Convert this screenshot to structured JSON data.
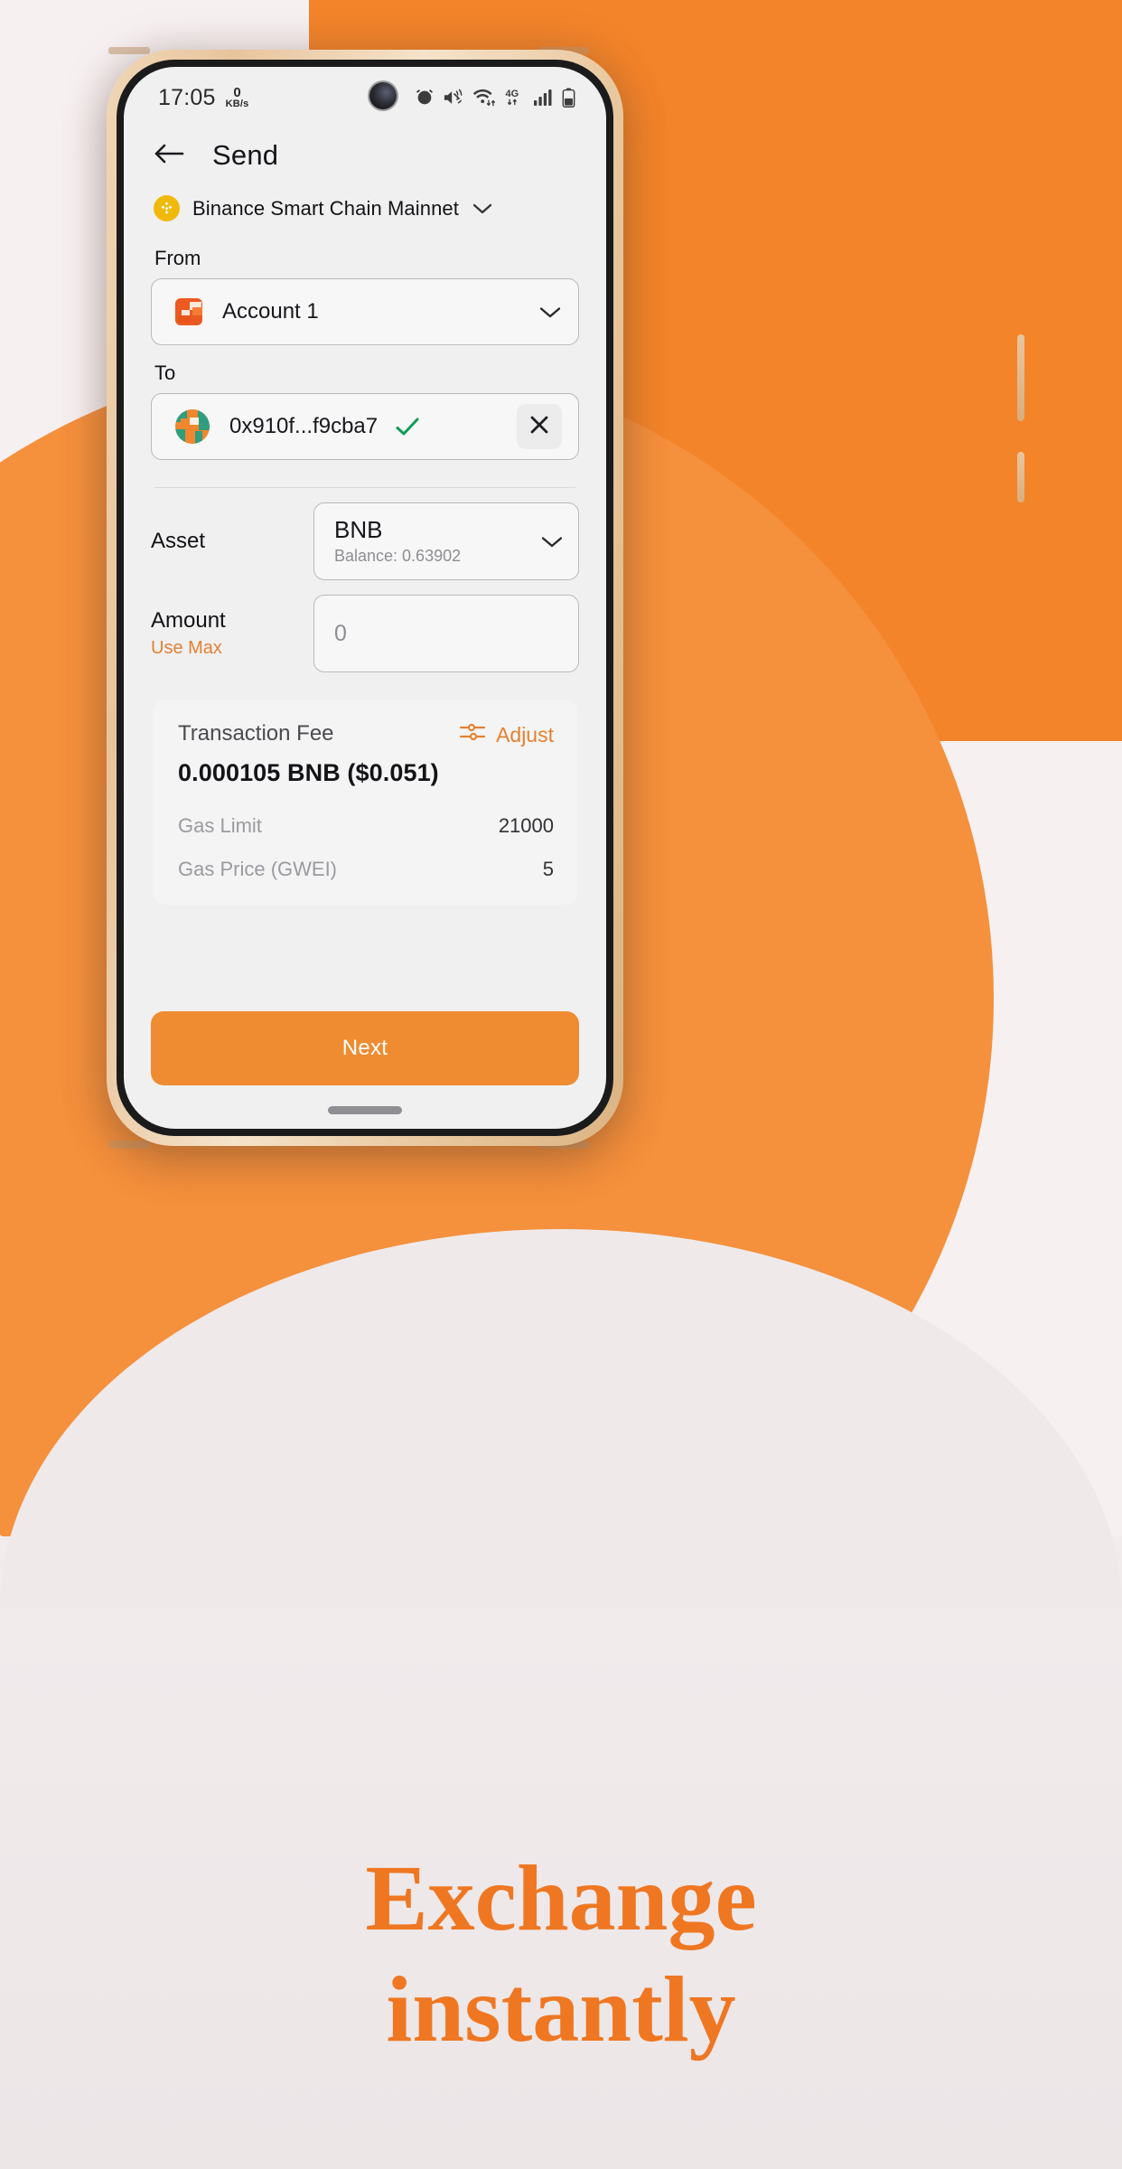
{
  "statusbar": {
    "time": "17:05",
    "net_speed_value": "0",
    "net_speed_unit": "KB/s",
    "network_type": "4G",
    "icons": [
      "alarm-icon",
      "mute-vibrate-icon",
      "wifi-icon",
      "mobile-data-4g-icon",
      "signal-bars-icon",
      "battery-icon"
    ]
  },
  "header": {
    "back_icon": "arrow-left-icon",
    "title": "Send"
  },
  "network": {
    "icon": "binance-coin-icon",
    "name": "Binance Smart Chain Mainnet",
    "chevron": "chevron-down-icon"
  },
  "from": {
    "label": "From",
    "account_name": "Account 1",
    "avatar": "account-identicon",
    "chevron": "chevron-down-icon"
  },
  "to": {
    "label": "To",
    "address": "0x910f...f9cba7",
    "avatar": "recipient-jazzicon",
    "valid_icon": "check-icon",
    "clear_icon": "close-icon"
  },
  "asset": {
    "label": "Asset",
    "symbol": "BNB",
    "balance": "Balance: 0.63902",
    "chevron": "chevron-down-icon"
  },
  "amount": {
    "label": "Amount",
    "use_max": "Use Max",
    "placeholder": "0",
    "value": ""
  },
  "fee": {
    "title": "Transaction Fee",
    "adjust_label": "Adjust",
    "adjust_icon": "sliders-icon",
    "amount": "0.000105 BNB ($0.051)",
    "rows": [
      {
        "key": "Gas Limit",
        "value": "21000"
      },
      {
        "key": "Gas Price (GWEI)",
        "value": "5"
      }
    ]
  },
  "primary_action": {
    "label": "Next"
  },
  "tagline": {
    "line1": "Exchange",
    "line2": "instantly"
  },
  "colors": {
    "accent_orange": "#ef7722",
    "button_orange": "#ef8c31",
    "binance_yellow": "#F0B90B",
    "check_green": "#0f9d58",
    "screen_bg": "#f0f0f0",
    "page_bg": "#f7f0f1"
  }
}
